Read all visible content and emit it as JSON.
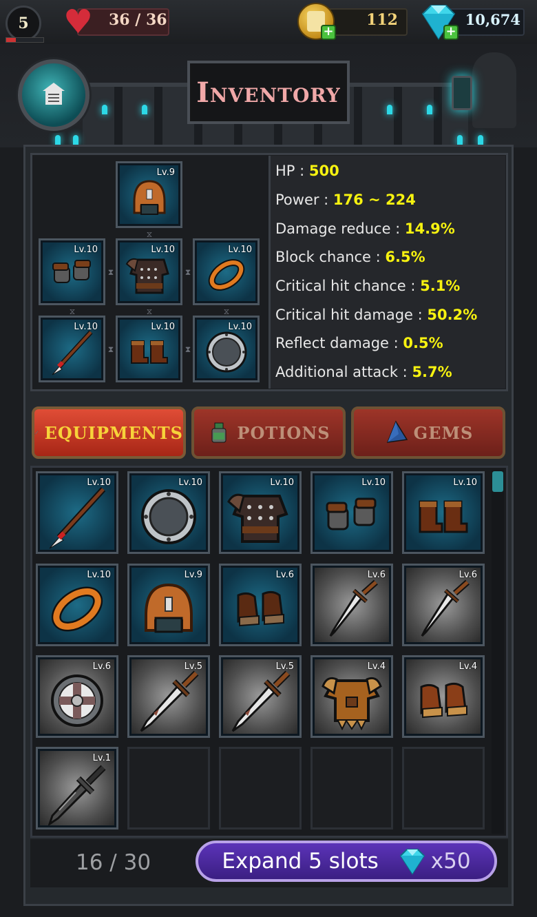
{
  "top_bar": {
    "player_level": "5",
    "xp_progress": 0.25,
    "hp": "36 / 36",
    "coins": "112",
    "gems": "10,674"
  },
  "header": {
    "title": "Inventory"
  },
  "equipped": [
    {
      "slot": "helmet",
      "level": "Lv.9"
    },
    {
      "slot": "gloves",
      "level": "Lv.10"
    },
    {
      "slot": "armor",
      "level": "Lv.10"
    },
    {
      "slot": "ring",
      "level": "Lv.10"
    },
    {
      "slot": "spear",
      "level": "Lv.10"
    },
    {
      "slot": "boots",
      "level": "Lv.10"
    },
    {
      "slot": "shield",
      "level": "Lv.10"
    }
  ],
  "stats": [
    {
      "label": "HP : ",
      "value": "500"
    },
    {
      "label": "Power : ",
      "value": "176 ~ 224"
    },
    {
      "label": "Damage reduce : ",
      "value": "14.9%"
    },
    {
      "label": "Block chance : ",
      "value": "6.5%"
    },
    {
      "label": "Critical hit chance : ",
      "value": "5.1%"
    },
    {
      "label": "Critical hit damage : ",
      "value": "50.2%"
    },
    {
      "label": "Reflect damage : ",
      "value": "0.5%"
    },
    {
      "label": "Additional attack : ",
      "value": "5.7%"
    }
  ],
  "tabs": [
    {
      "label": "EQUIPMENTS",
      "active": true
    },
    {
      "label": "POTIONS",
      "active": false
    },
    {
      "label": "GEMS",
      "active": false
    }
  ],
  "inventory": [
    {
      "item": "spear",
      "level": "Lv.10"
    },
    {
      "item": "shield",
      "level": "Lv.10"
    },
    {
      "item": "armor",
      "level": "Lv.10"
    },
    {
      "item": "gloves",
      "level": "Lv.10"
    },
    {
      "item": "boots",
      "level": "Lv.10"
    },
    {
      "item": "ring",
      "level": "Lv.10"
    },
    {
      "item": "helmet",
      "level": "Lv.9"
    },
    {
      "item": "boots",
      "level": "Lv.6"
    },
    {
      "item": "dagger",
      "level": "Lv.6"
    },
    {
      "item": "dagger",
      "level": "Lv.6"
    },
    {
      "item": "round-shield",
      "level": "Lv.6"
    },
    {
      "item": "sword",
      "level": "Lv.5"
    },
    {
      "item": "sword",
      "level": "Lv.5"
    },
    {
      "item": "leather-armor",
      "level": "Lv.4"
    },
    {
      "item": "boots",
      "level": "Lv.4"
    },
    {
      "item": "short-sword",
      "level": "Lv.1"
    }
  ],
  "slot_count": "16 / 30",
  "expand": {
    "label": "Expand 5 slots",
    "cost": "x50"
  },
  "colors": {
    "stat_value": "#f6f210",
    "rare_slot": "#0d3346",
    "common_slot": "#4d4d4d",
    "tab_active": "#e04d36",
    "expand_button": "#4a2a9e"
  }
}
